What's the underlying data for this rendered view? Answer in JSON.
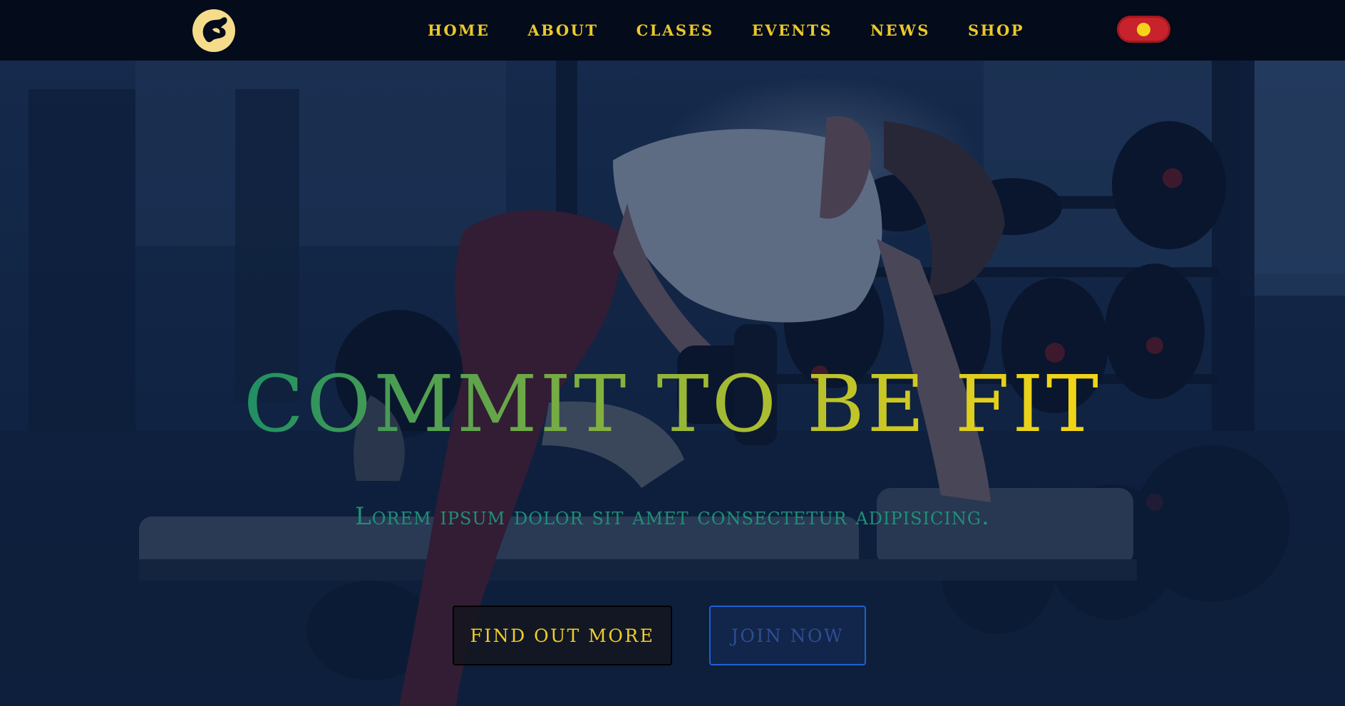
{
  "nav": {
    "logo_icon": "flexed-arm-logo-icon",
    "links": [
      {
        "label": "HOME"
      },
      {
        "label": "ABOUT"
      },
      {
        "label": "CLASES"
      },
      {
        "label": "EVENTS"
      },
      {
        "label": "NEWS"
      },
      {
        "label": "SHOP"
      }
    ],
    "toggle_icon": "language-toggle-icon"
  },
  "hero": {
    "title": "COMMIT TO BE FIT",
    "subtitle": "Lorem ipsum dolor sit amet consectetur adipisicing.",
    "primary_button": "FIND OUT MORE",
    "secondary_button": "JOIN NOW"
  },
  "colors": {
    "nav_bg": "#040b1a",
    "accent_yellow": "#e9c92c",
    "toggle_red": "#c8232d",
    "title_gradient_start": "#1e8f63",
    "title_gradient_end": "#f0d418",
    "subtitle_teal": "#1f8f76",
    "join_border_blue": "#1f5fd0"
  }
}
